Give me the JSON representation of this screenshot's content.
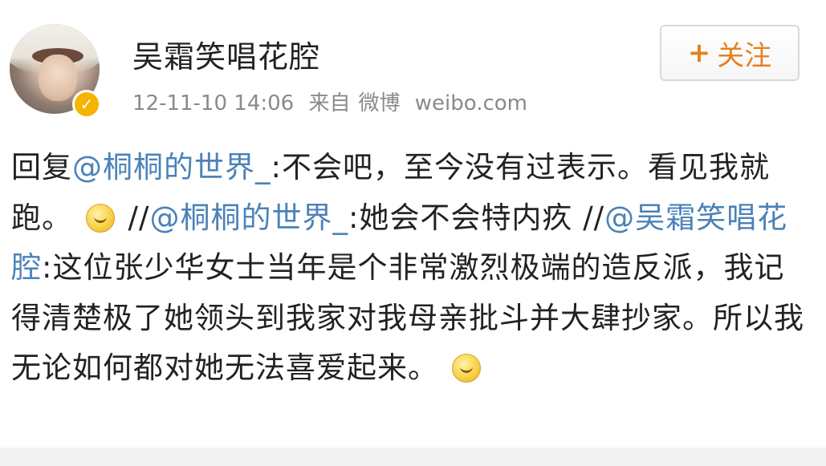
{
  "post": {
    "username": "吴霜笑唱花腔",
    "time": "12-11-10 14:06",
    "source_prefix": "来自",
    "source_app": "微博",
    "source_site": "weibo.com",
    "follow_plus": "+",
    "follow_label": "关注",
    "body": {
      "reply_prefix": "回复",
      "mention1": "@桐桐的世界_",
      "text1": ":不会吧，至今没有过表示。看见我就跑。",
      "emoji1": "smirk-emoji",
      "sep1": " //",
      "mention2": "@桐桐的世界_",
      "text2": ":她会不会特内疚 //",
      "mention3": "@吴霜笑唱花腔",
      "text3": ":这位张少华女士当年是个非常激烈极端的造反派，我记得清楚极了她领头到我家对我母亲批斗并大肆抄家。所以我无论如何都对她无法喜爱起来。",
      "emoji2": "grin-emoji"
    }
  },
  "colors": {
    "mention": "#4b82b8",
    "follow": "#e3831f",
    "verified": "#f4b400"
  }
}
